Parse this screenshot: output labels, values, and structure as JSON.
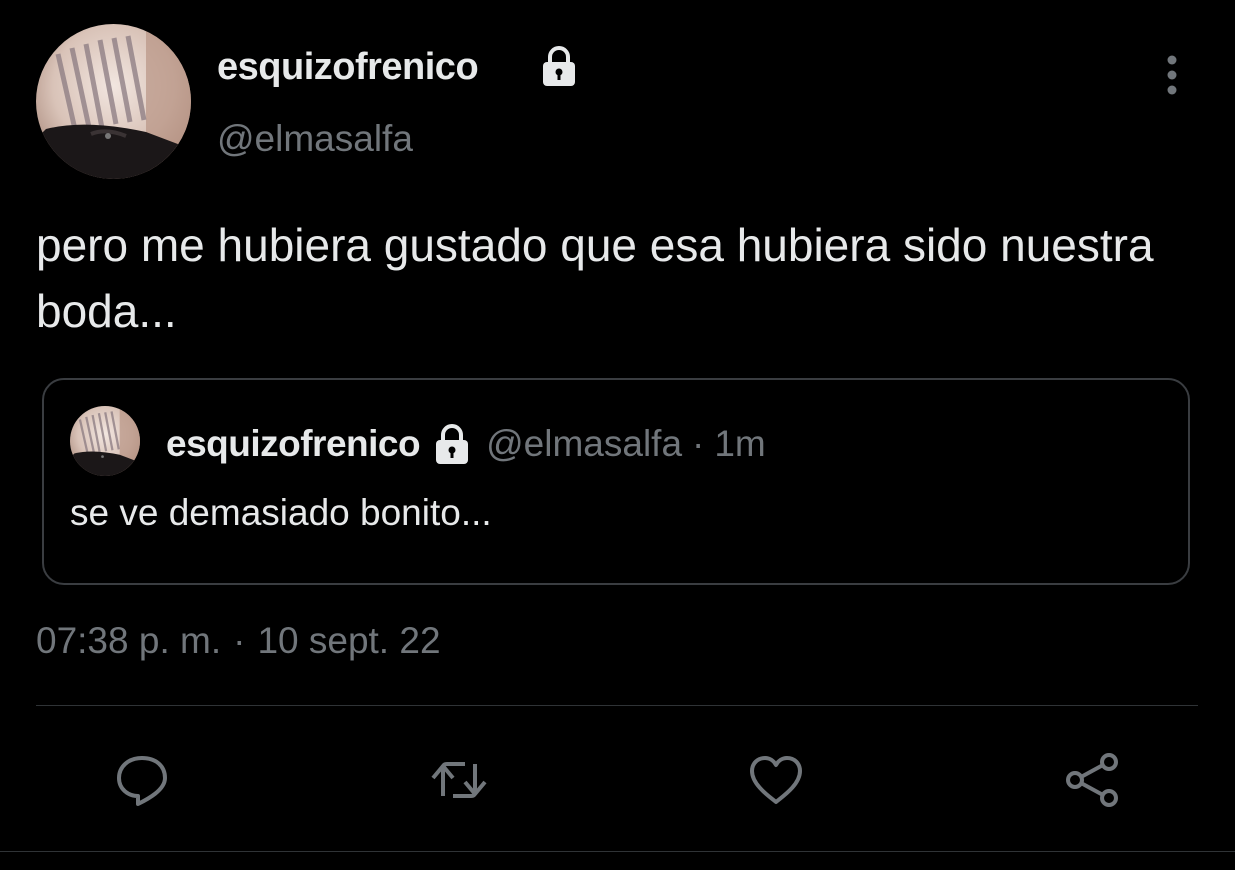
{
  "tweet": {
    "author": {
      "display_name": "esquizofrenico",
      "handle": "@elmasalfa",
      "protected_icon": "lock-icon",
      "avatar": "profile-photo"
    },
    "text": "pero me hubiera gustado que esa hubiera sido nuestra boda...",
    "more_icon": "more-vertical-icon",
    "quoted_tweet": {
      "display_name": "esquizofrenico",
      "handle": "@elmasalfa",
      "separator": "·",
      "time_ago": "1m",
      "protected_icon": "lock-icon",
      "text": "se ve demasiado bonito..."
    },
    "timestamp": {
      "time": "07:38 p. m.",
      "separator": "·",
      "date": "10 sept. 22"
    }
  },
  "actions": [
    {
      "name": "reply",
      "icon": "comment-icon"
    },
    {
      "name": "retweet",
      "icon": "retweet-icon"
    },
    {
      "name": "like",
      "icon": "heart-icon"
    },
    {
      "name": "share",
      "icon": "share-icon"
    }
  ],
  "colors": {
    "background": "#000000",
    "primary_text": "#e7e9ea",
    "secondary_text": "#71767b",
    "border": "#2f3336",
    "icon": "#71767b"
  }
}
